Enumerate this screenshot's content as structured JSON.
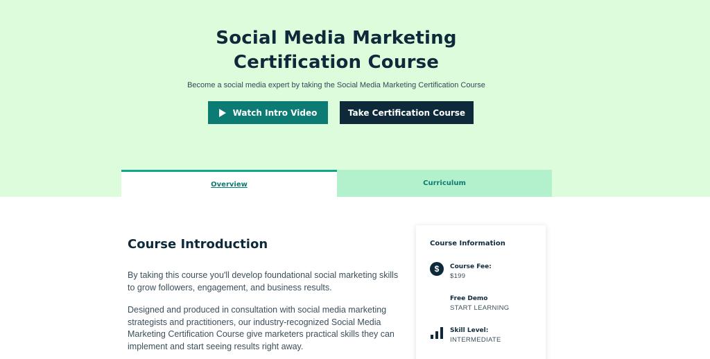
{
  "hero": {
    "title_line1": "Social Media Marketing",
    "title_line2": "Certification Course",
    "subtitle": "Become a social media expert by taking the Social Media Marketing Certification Course",
    "watch_button": "Watch Intro Video",
    "take_button": "Take Certification Course"
  },
  "tabs": [
    {
      "label": "Overview",
      "active": true
    },
    {
      "label": "Curriculum",
      "active": false
    }
  ],
  "content": {
    "heading": "Course Introduction",
    "paragraphs": [
      "By taking this course you'll develop foundational social marketing skills to grow followers, engagement, and business results.",
      "Designed and produced in consultation with social media marketing strategists and practitioners, our industry-recognized Social Media Marketing Certification Course give marketers practical skills they can implement and start seeing results right away."
    ]
  },
  "card": {
    "title": "Course Information",
    "items": [
      {
        "label": "Course Fee:",
        "value": "$199",
        "icon": "dollar-icon"
      },
      {
        "label": "Free Demo",
        "value": "START LEARNING",
        "icon": ""
      },
      {
        "label": "Skill Level:",
        "value": "INTERMEDIATE",
        "icon": "bar-chart-icon"
      }
    ]
  },
  "colors": {
    "hero_bg": "#ddfcdc",
    "primary_teal": "#0c7b74",
    "dark_navy": "#0e2a3a",
    "tab_inactive_bg": "#b3f0cc",
    "tab_active_border": "#12a58e"
  },
  "icons": {
    "dollar": "$"
  }
}
